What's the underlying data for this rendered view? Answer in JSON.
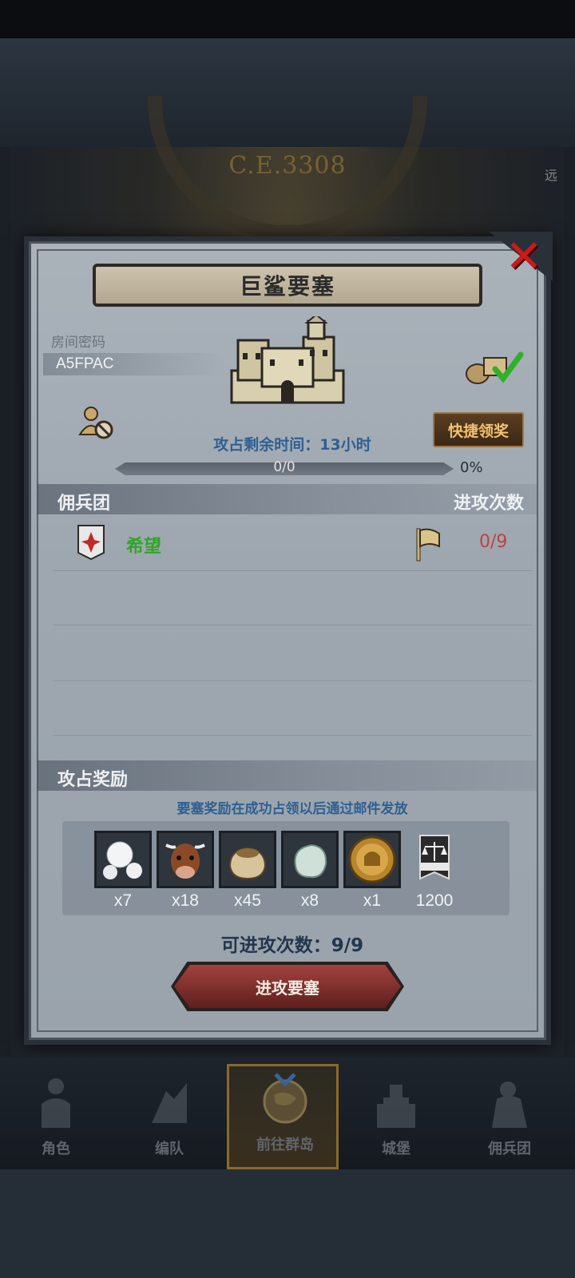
{
  "background": {
    "era_label": "C.E.3308",
    "side_tag": "远"
  },
  "dialog": {
    "title": "巨鲨要塞",
    "close_icon": "close-x-icon",
    "room_password_label": "房间密码",
    "room_password": "A5FPAC",
    "quick_claim_label": "快捷领奖",
    "time_remaining_label": "攻占剩余时间：13小时",
    "progress_text": "0/0",
    "progress_percent_text": "0%",
    "progress_value": 0,
    "mercenary_header": "佣兵团",
    "attack_count_header": "进攻次数",
    "guilds": [
      {
        "name": "希望",
        "attacks": "0/9"
      }
    ],
    "reward_header": "攻占奖励",
    "reward_note": "要塞奖励在成功占领以后通过邮件发放",
    "rewards": [
      {
        "icon": "pearl-icon",
        "qty": "x7"
      },
      {
        "icon": "cow-icon",
        "qty": "x18"
      },
      {
        "icon": "grain-sack-icon",
        "qty": "x45"
      },
      {
        "icon": "stone-icon",
        "qty": "x8"
      },
      {
        "icon": "knight-medal-icon",
        "qty": "x1"
      },
      {
        "icon": "scales-banner-icon",
        "qty": "1200"
      }
    ],
    "attacks_available_label": "可进攻次数：9/9",
    "attack_button_label": "进攻要塞"
  },
  "bottom_nav": [
    {
      "label": "角色",
      "icon": "knight-icon",
      "active": false
    },
    {
      "label": "编队",
      "icon": "formation-icon",
      "active": false
    },
    {
      "label": "前往群岛",
      "icon": "globe-icon",
      "active": true
    },
    {
      "label": "城堡",
      "icon": "castle-icon",
      "active": false
    },
    {
      "label": "佣兵团",
      "icon": "mercenary-icon",
      "active": false
    }
  ],
  "colors": {
    "title_text": "#2b2b2b",
    "blue_text": "#2f5f92",
    "guild_green": "#2fa628",
    "attack_red": "#c24040",
    "close_red": "#d01818",
    "claim_gold": "#f0c170"
  }
}
